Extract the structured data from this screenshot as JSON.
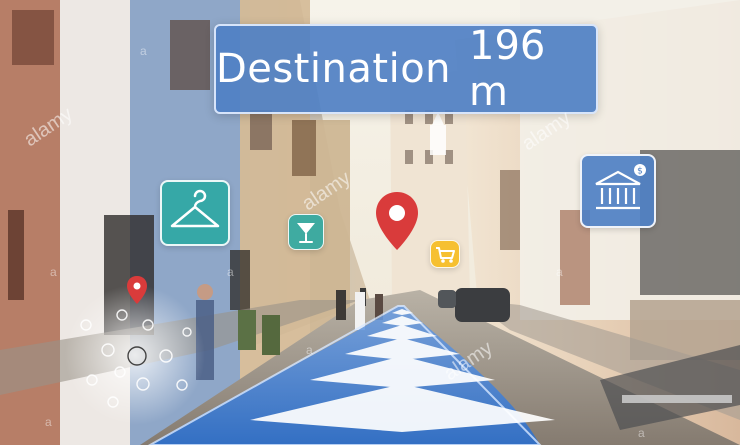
{
  "overlay": {
    "destination_label": "Destination",
    "distance": "196 m"
  },
  "watermarks": {
    "brand": "alamy",
    "small": "a"
  },
  "icons": {
    "clothing": "hanger-icon",
    "bar": "cocktail-glass-icon",
    "shop": "shopping-cart-icon",
    "bank": "bank-building-icon",
    "destination": "location-pin-icon",
    "map": "map-pin-icon"
  },
  "colors": {
    "route": "#3f7fd2",
    "chevron": "#ffffff",
    "teal": "#2aa8a2",
    "blue_panel": "#4f80c4",
    "pin_red": "#d93b3b",
    "shop_yellow": "#f5be28"
  }
}
